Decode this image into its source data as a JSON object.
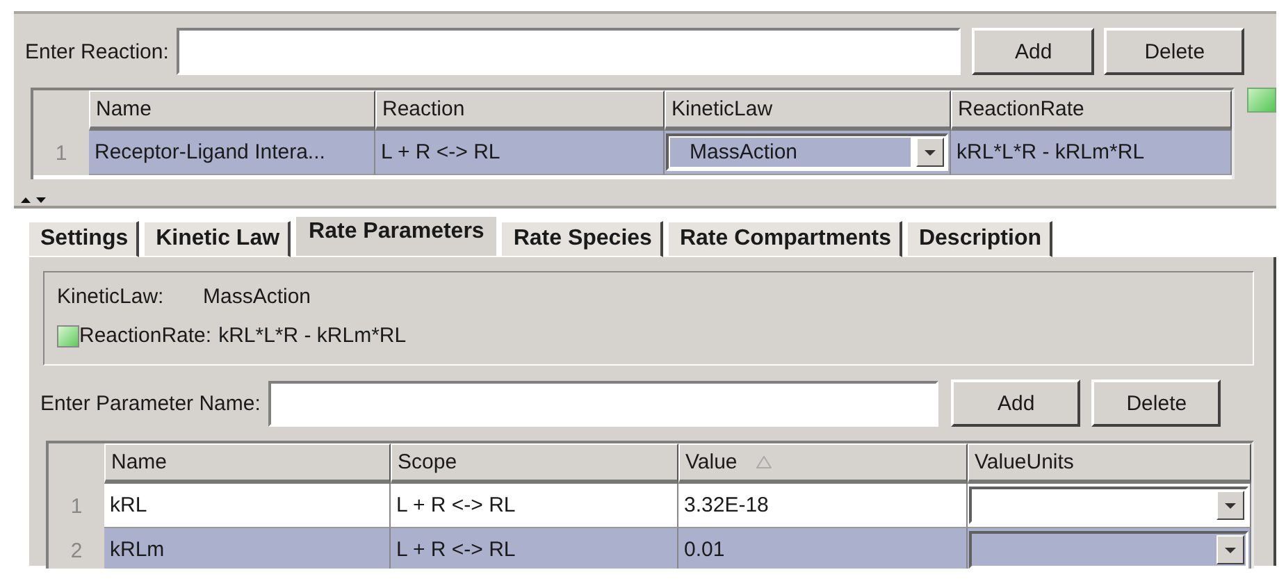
{
  "reaction_entry": {
    "label": "Enter Reaction:",
    "buttons": [
      "Add",
      "Delete"
    ]
  },
  "reactions_table": {
    "columns": [
      "Name",
      "Reaction",
      "KineticLaw",
      "ReactionRate"
    ],
    "rows": [
      {
        "number": "1",
        "selected": true,
        "name": "Receptor-Ligand Intera...",
        "reaction": "L + R <-> RL",
        "kinetic_law": "MassAction",
        "reaction_rate": "kRL*L*R - kRLm*RL"
      }
    ]
  },
  "tabs": [
    {
      "label": "Settings",
      "selected": false
    },
    {
      "label": "Kinetic Law",
      "selected": false
    },
    {
      "label": "Rate Parameters",
      "selected": true
    },
    {
      "label": "Rate Species",
      "selected": false
    },
    {
      "label": "Rate Compartments",
      "selected": false
    },
    {
      "label": "Description",
      "selected": false
    }
  ],
  "summary": {
    "kinetic_law_label": "KineticLaw:",
    "kinetic_law": "MassAction",
    "reaction_rate_label": "ReactionRate:",
    "reaction_rate": "kRL*L*R - kRLm*RL"
  },
  "parameter_entry": {
    "label": "Enter Parameter Name:",
    "buttons": [
      "Add",
      "Delete"
    ]
  },
  "parameters_table": {
    "columns": [
      {
        "label": "Name",
        "sorted": false
      },
      {
        "label": "Scope",
        "sorted": false
      },
      {
        "label": "Value",
        "sorted": true
      },
      {
        "label": "ValueUnits",
        "sorted": false
      }
    ],
    "rows": [
      {
        "number": "1",
        "selected": false,
        "name": "kRL",
        "scope": "L + R <-> RL",
        "value": "3.32E-18"
      },
      {
        "number": "2",
        "selected": true,
        "name": "kRLm",
        "scope": "L + R <-> RL",
        "value": "0.01"
      }
    ]
  }
}
